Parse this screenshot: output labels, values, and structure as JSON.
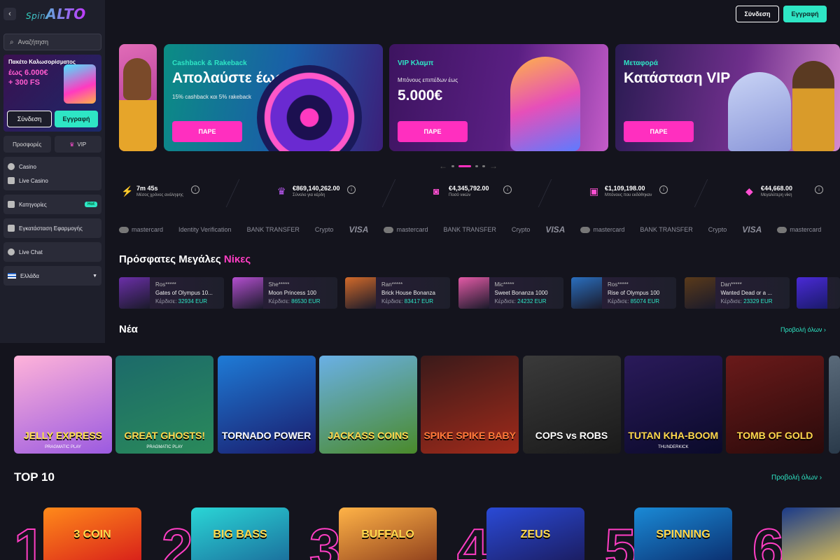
{
  "sidebar": {
    "search_placeholder": "Αναζήτηση",
    "promo": {
      "title": "Πακέτο Καλωσορίσματος",
      "line1": "έως 6.000€",
      "line2": "+ 300 FS"
    },
    "login": "Σύνδεση",
    "register": "Εγγραφή",
    "offers": "Προσφορές",
    "vip": "VIP",
    "casino": "Casino",
    "live_casino": "Live Casino",
    "categories": "Κατηγορίες",
    "hot_badge": "Hot",
    "install_app": "Εγκατάσταση Εφαρμογής",
    "live_chat": "Live Chat",
    "language": "Ελλάδα"
  },
  "header": {
    "login": "Σύνδεση",
    "register": "Εγγραφή"
  },
  "banners": [
    {
      "sub": "Cashback & Rakeback",
      "title": "Απολαύστε έως",
      "desc": "15% cashback και 5% rakeback",
      "cta": "ΠΑΡΕ"
    },
    {
      "sub": "VIP Κλαμπ",
      "desc": "Μπόνους επιπέδων έως",
      "big": "5.000€",
      "cta": "ΠΑΡΕ"
    },
    {
      "sub": "Μεταφορά",
      "title": "Κατάσταση VIP",
      "cta": "ΠΑΡΕ"
    }
  ],
  "carousel": {
    "prev": "←",
    "next": "→",
    "active_index": 1,
    "count": 4
  },
  "stats": [
    {
      "value": "7m 45s",
      "label": "Μέσος χρόνος ανάληψης",
      "icon": "lightning-icon"
    },
    {
      "value": "€869,140,262.00",
      "label": "Σύνολο για κέρδη",
      "icon": "crown-icon"
    },
    {
      "value": "€4,345,792.00",
      "label": "Ποσό νικών",
      "icon": "bag-icon"
    },
    {
      "value": "€1,109,198.00",
      "label": "Μπόνους που εκδόθηκαν",
      "icon": "gift-icon"
    },
    {
      "value": "€44,668.00",
      "label": "Μεγαλύτερη νίκη",
      "icon": "diamond-icon"
    }
  ],
  "payments": [
    "mastercard",
    "Identity Verification",
    "BANK TRANSFER",
    "Crypto",
    "VISA",
    "mastercard",
    "BANK TRANSFER",
    "Crypto",
    "VISA",
    "mastercard",
    "BANK TRANSFER",
    "Crypto",
    "VISA",
    "mastercard"
  ],
  "recent_wins": {
    "title_a": "Πρόσφατες Μεγάλες",
    "title_b": "Νίκες",
    "won_label": "Κέρδισε:",
    "items": [
      {
        "user": "Ros*****",
        "game": "Gates of Olympus 10...",
        "amount": "32934 EUR",
        "color": "#6b2fa8"
      },
      {
        "user": "She*****",
        "game": "Moon Princess 100",
        "amount": "86530 EUR",
        "color": "#b34fcf"
      },
      {
        "user": "Ran*****",
        "game": "Brick House Bonanza",
        "amount": "83417 EUR",
        "color": "#d26a2a"
      },
      {
        "user": "Mic*****",
        "game": "Sweet Bonanza 1000",
        "amount": "24232 EUR",
        "color": "#e35aa6"
      },
      {
        "user": "Ros*****",
        "game": "Rise of Olympus 100",
        "amount": "85074 EUR",
        "color": "#2a6fbf"
      },
      {
        "user": "Dan*****",
        "game": "Wanted Dead or a ...",
        "amount": "23329 EUR",
        "color": "#5a3a1a"
      }
    ]
  },
  "new_games": {
    "title": "Νέα",
    "view_all": "Προβολή όλων",
    "items": [
      {
        "name": "JELLY EXPRESS",
        "provider": "PRAGMATIC PLAY",
        "bg": "linear-gradient(160deg,#ffb3d9,#9b5ae0)",
        "fg": "#ffe14d"
      },
      {
        "name": "GREAT GHOSTS!",
        "provider": "PRAGMATIC PLAY",
        "bg": "linear-gradient(160deg,#1c6a6a,#2a8a5a)",
        "fg": "#ffd84d"
      },
      {
        "name": "TORNADO POWER",
        "provider": "",
        "bg": "linear-gradient(160deg,#1e7bd6,#1a1a6a)",
        "fg": "#ffffff"
      },
      {
        "name": "JACKASS COINS",
        "provider": "",
        "bg": "linear-gradient(160deg,#6ab0e6,#4a8a2a)",
        "fg": "#ffd84d"
      },
      {
        "name": "SPIKE SPIKE BABY",
        "provider": "",
        "bg": "linear-gradient(160deg,#3a1a1a,#a02a1a)",
        "fg": "#ff7a3a"
      },
      {
        "name": "COPS vs ROBS",
        "provider": "",
        "bg": "linear-gradient(160deg,#3a3a3a,#1a1a1a)",
        "fg": "#ffffff"
      },
      {
        "name": "TUTAN KHA-BOOM",
        "provider": "THUNDERKICK",
        "bg": "linear-gradient(160deg,#2a1a5a,#0a0a2a)",
        "fg": "#ffd84d"
      },
      {
        "name": "TOMB OF GOLD",
        "provider": "",
        "bg": "linear-gradient(160deg,#6a1a1a,#2a0a0a)",
        "fg": "#ffd84d"
      }
    ]
  },
  "top10": {
    "title": "TOP 10",
    "view_all": "Προβολή όλων",
    "items": [
      {
        "rank": "1",
        "name": "3 COIN",
        "bg": "linear-gradient(160deg,#ff8a1a,#d61a1a)"
      },
      {
        "rank": "2",
        "name": "BIG BASS",
        "bg": "linear-gradient(160deg,#2ad6d6,#1a6a9a)"
      },
      {
        "rank": "3",
        "name": "BUFFALO",
        "bg": "linear-gradient(160deg,#ffb347,#8a3a1a)"
      },
      {
        "rank": "4",
        "name": "ZEUS",
        "bg": "linear-gradient(160deg,#2a4ad6,#1a1a5a)"
      },
      {
        "rank": "5",
        "name": "SPINNING",
        "bg": "linear-gradient(160deg,#1a8ad6,#0a2a6a)"
      },
      {
        "rank": "6",
        "name": "",
        "bg": "linear-gradient(160deg,#1a3a8a,#ffd84d)"
      }
    ]
  }
}
